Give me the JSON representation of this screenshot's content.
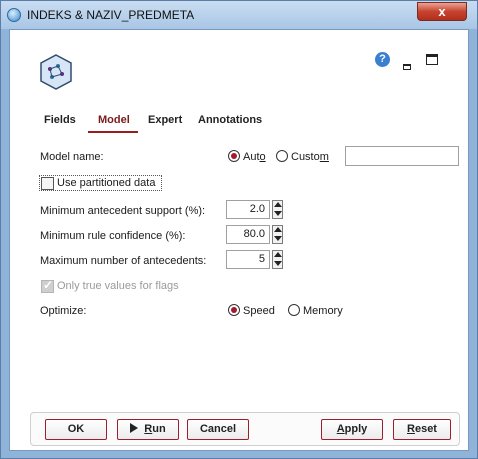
{
  "window": {
    "title": "INDEKS & NAZIV_PREDMETA",
    "close_label": "x"
  },
  "header": {
    "help_label": "?"
  },
  "tabs": [
    {
      "label": "Fields",
      "active": false
    },
    {
      "label": "Model",
      "active": true
    },
    {
      "label": "Expert",
      "active": false
    },
    {
      "label": "Annotations",
      "active": false
    }
  ],
  "model_name": {
    "label": "Model name:",
    "option_auto": {
      "pre": "Aut",
      "key": "o",
      "selected": true
    },
    "option_custom": {
      "pre": "Custo",
      "key": "m",
      "selected": false
    },
    "custom_value": ""
  },
  "use_partitioned": {
    "label": "Use partitioned data",
    "checked": false
  },
  "min_antecedent_support": {
    "label": "Minimum antecedent support (%):",
    "value": "2.0"
  },
  "min_rule_confidence": {
    "label": "Minimum rule confidence (%):",
    "value": "80.0"
  },
  "max_antecedents": {
    "label": "Maximum number of antecedents:",
    "value": "5"
  },
  "only_true_values": {
    "label": "Only true values for flags",
    "checked": true,
    "enabled": false
  },
  "optimize": {
    "label": "Optimize:",
    "option_speed": {
      "label": "Speed",
      "selected": true
    },
    "option_memory": {
      "label": "Memory",
      "selected": false
    }
  },
  "buttons": {
    "ok": "OK",
    "run": {
      "key": "R",
      "rest": "un"
    },
    "cancel": "Cancel",
    "apply": {
      "key": "A",
      "rest": "pply"
    },
    "reset": {
      "key": "R",
      "rest": "eset"
    }
  },
  "colors": {
    "accent": "#9c1b1b",
    "frame": "#8fb3d9",
    "close": "#c7432f"
  },
  "icons": [
    "app-icon",
    "node-icon",
    "help-icon",
    "minimize-icon",
    "maximize-icon",
    "close-icon",
    "run-arrow-icon",
    "spin-up-icon",
    "spin-down-icon"
  ]
}
